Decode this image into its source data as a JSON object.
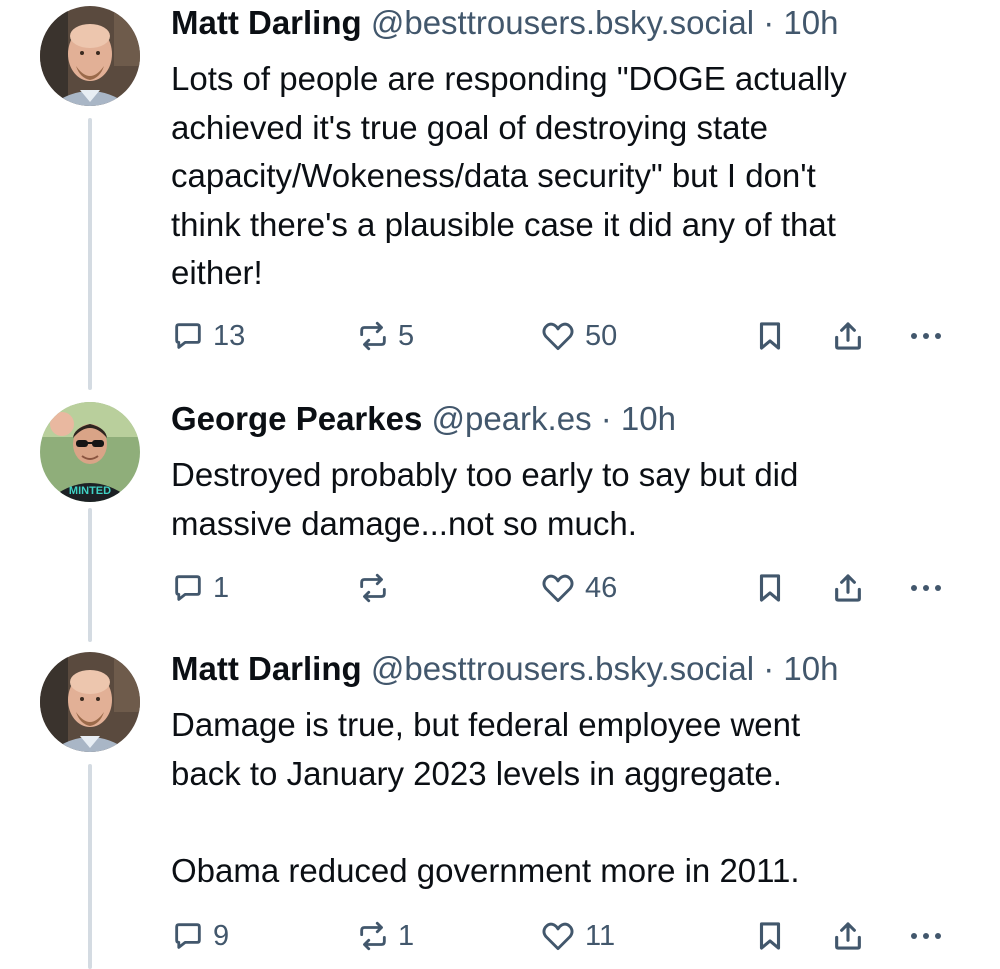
{
  "posts": [
    {
      "author_name": "Matt Darling",
      "handle": "@besttrousers.bsky.social",
      "separator": "·",
      "time": "10h",
      "avatar": "bald-man-avatar",
      "text": "Lots of people are responding \"DOGE actually\nachieved it's true goal of destroying state\ncapacity/Wokeness/data security\" but I don't\nthink there's a plausible case it did any of that\neither!",
      "reply_count": "13",
      "repost_count": "5",
      "like_count": "50"
    },
    {
      "author_name": "George Pearkes",
      "handle": "@peark.es",
      "separator": "·",
      "time": "10h",
      "avatar": "man-with-sunglasses-avatar",
      "avatar_shirt_text": "MINTED",
      "text": "Destroyed probably too early to say but did\nmassive damage...not so much.",
      "reply_count": "1",
      "repost_count": "",
      "like_count": "46"
    },
    {
      "author_name": "Matt Darling",
      "handle": "@besttrousers.bsky.social",
      "separator": "·",
      "time": "10h",
      "avatar": "bald-man-avatar",
      "text": "Damage is true, but federal employee went\nback to January 2023 levels in aggregate.\n\nObama reduced government more in 2011.",
      "reply_count": "9",
      "repost_count": "1",
      "like_count": "11"
    }
  ],
  "icons": {
    "reply": "reply-bubble-icon",
    "repost": "repost-arrows-icon",
    "like": "heart-icon",
    "bookmark": "bookmark-icon",
    "share": "share-icon",
    "more": "more-ellipsis-icon"
  },
  "colors": {
    "text": "#0b0f14",
    "muted": "#42576c",
    "thread_line": "#d4dbe2",
    "background": "#ffffff"
  }
}
